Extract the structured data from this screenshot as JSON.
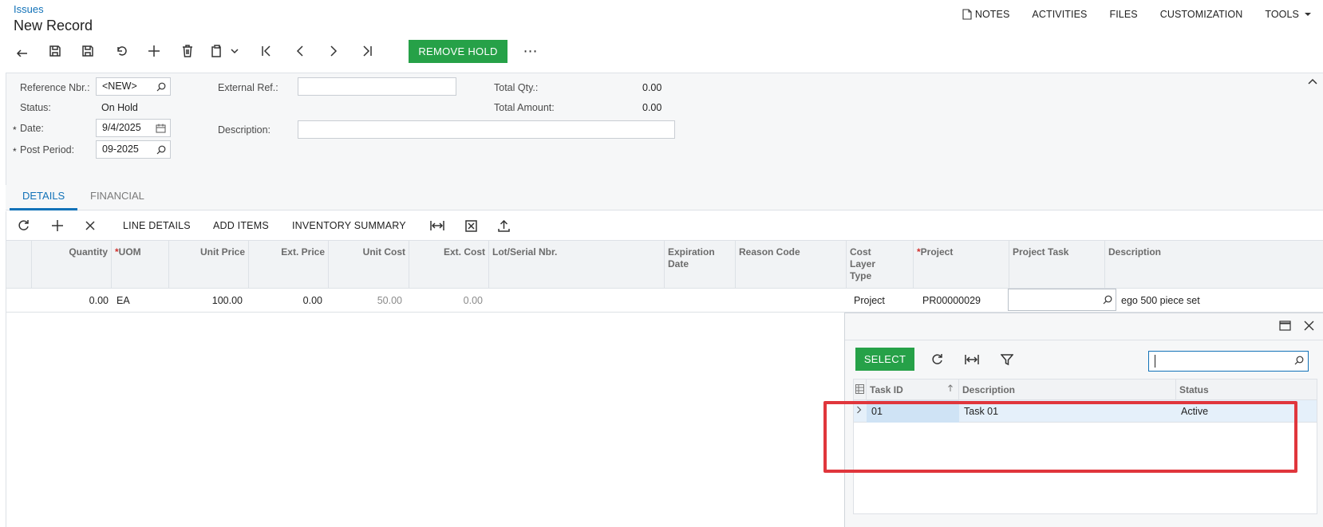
{
  "header": {
    "breadcrumb": "Issues",
    "title": "New Record",
    "nav": {
      "notes": "NOTES",
      "activities": "ACTIVITIES",
      "files": "FILES",
      "customization": "CUSTOMIZATION",
      "tools": "TOOLS"
    }
  },
  "toolbar": {
    "remove_hold": "REMOVE HOLD",
    "more": "⋯"
  },
  "form": {
    "reference_label": "Reference Nbr.:",
    "reference_value": "<NEW>",
    "status_label": "Status:",
    "status_value": "On Hold",
    "date_label": "Date:",
    "date_value": "9/4/2025",
    "post_period_label": "Post Period:",
    "post_period_value": "09-2025",
    "external_ref_label": "External Ref.:",
    "external_ref_value": "",
    "description_label": "Description:",
    "description_value": "",
    "total_qty_label": "Total Qty.:",
    "total_qty_value": "0.00",
    "total_amount_label": "Total Amount:",
    "total_amount_value": "0.00",
    "required_mark": "*"
  },
  "tabs": {
    "details": "DETAILS",
    "financial": "FINANCIAL"
  },
  "grid_toolbar": {
    "line_details": "LINE DETAILS",
    "add_items": "ADD ITEMS",
    "inventory_summary": "INVENTORY SUMMARY"
  },
  "grid": {
    "columns": {
      "quantity": "Quantity",
      "uom": "UOM",
      "unit_price": "Unit Price",
      "ext_price": "Ext. Price",
      "unit_cost": "Unit Cost",
      "ext_cost": "Ext. Cost",
      "lot_serial": "Lot/Serial Nbr.",
      "expiration_date_1": "Expiration",
      "expiration_date_2": "Date",
      "reason_code": "Reason Code",
      "cost_layer_1": "Cost",
      "cost_layer_2": "Layer",
      "cost_layer_3": "Type",
      "project": "Project",
      "project_task": "Project Task",
      "description": "Description"
    },
    "row": {
      "quantity": "0.00",
      "uom": "EA",
      "unit_price": "100.00",
      "ext_price": "0.00",
      "unit_cost": "50.00",
      "ext_cost": "0.00",
      "cost_layer_type": "Project",
      "project": "PR00000029",
      "description": "ego 500 piece set"
    }
  },
  "popup": {
    "select": "SELECT",
    "search_value": "",
    "columns": {
      "task_id": "Task ID",
      "description": "Description",
      "status": "Status"
    },
    "rows": [
      {
        "task_id": "01",
        "description": "Task 01",
        "status": "Active"
      }
    ]
  },
  "colors": {
    "accent": "#1272b8",
    "primary_button": "#26a148",
    "highlight_border": "#e0363c",
    "selected_row": "#e5f0fa"
  }
}
